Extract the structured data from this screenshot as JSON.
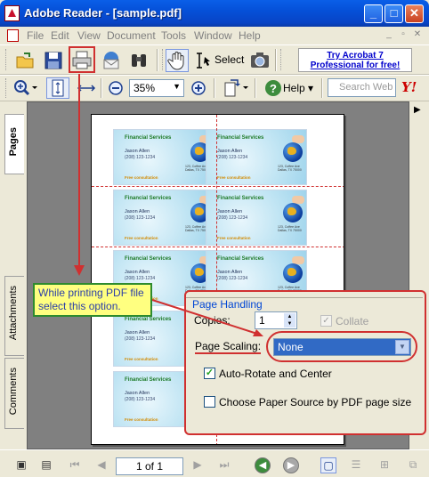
{
  "window": {
    "title": "Adobe Reader - [sample.pdf]",
    "minimize": "_",
    "maximize": "□",
    "close": "✕"
  },
  "menu": [
    "File",
    "Edit",
    "View",
    "Document",
    "Tools",
    "Window",
    "Help"
  ],
  "mdi": {
    "minimize": "_",
    "restore": "▫",
    "close": "✕"
  },
  "toolbar": {
    "select_label": "Select",
    "promo": "Try Acrobat 7 Professional for free!",
    "zoom_value": "35%",
    "help_label": "Help",
    "search_placeholder": "Search Web",
    "yahoo": "Y!"
  },
  "nav_tabs": [
    "Pages",
    "Attachments",
    "Comments"
  ],
  "cards": {
    "company": "Financial Services",
    "name": "Jason Allen",
    "phone": "(208) 123-1234",
    "address": "123, Coffee Ave\nDallas, TX 75000",
    "free": "Free consultation"
  },
  "status": {
    "page": "1 of 1"
  },
  "dialog": {
    "group_title": "Page Handling",
    "copies_label": "Copies:",
    "copies_value": "1",
    "collate_label": "Collate",
    "collate_checked": true,
    "scaling_label": "Page Scaling:",
    "scaling_value": "None",
    "auto_rotate_label": "Auto-Rotate and Center",
    "auto_rotate_checked": true,
    "paper_source_label": "Choose Paper Source by PDF page size",
    "paper_source_checked": false
  },
  "callout": "While printing PDF file select this option.",
  "colors": {
    "annotation": "#D03030",
    "callout_bg": "#FFFF80",
    "callout_text": "#2C3FA8",
    "selection": "#316AC5"
  }
}
